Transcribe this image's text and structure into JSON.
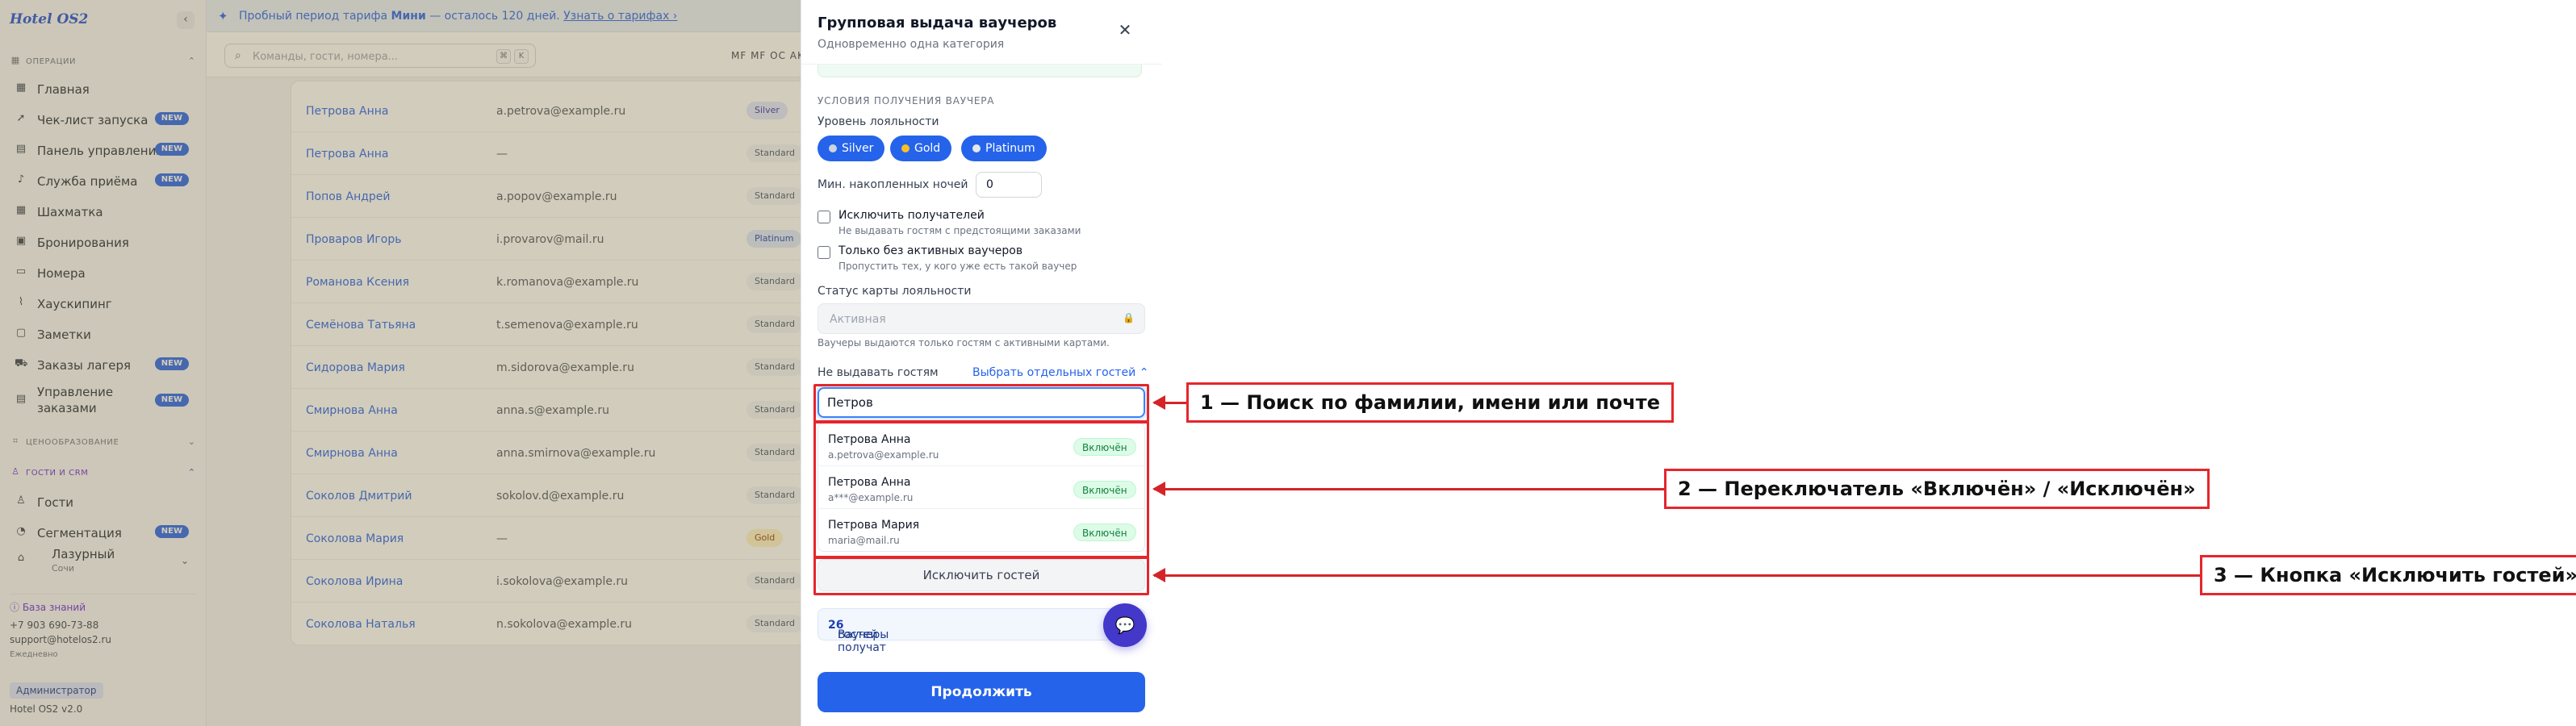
{
  "sidebar": {
    "logo": "Hotel OS2",
    "collapse_icon": "chevron-left-icon",
    "sections": {
      "operations": "ОПЕРАЦИИ",
      "pricing": "ЦЕНООБРАЗОВАНИЕ",
      "guests": "ГОСТИ И CRM"
    },
    "items": [
      {
        "label": "Главная",
        "icon": "grid-icon"
      },
      {
        "label": "Чек-лист запуска",
        "icon": "rocket-icon",
        "badge": "NEW"
      },
      {
        "label": "Панель управления",
        "icon": "dashboard-icon",
        "badge": "NEW"
      },
      {
        "label": "Служба приёма",
        "icon": "bell-icon",
        "badge": "NEW"
      },
      {
        "label": "Шахматка",
        "icon": "table-icon"
      },
      {
        "label": "Бронирования",
        "icon": "calendar-icon"
      },
      {
        "label": "Номера",
        "icon": "bed-icon"
      },
      {
        "label": "Хаускипинг",
        "icon": "broom-icon"
      },
      {
        "label": "Заметки",
        "icon": "note-icon"
      },
      {
        "label": "Заказы лагеря",
        "icon": "cart-icon",
        "badge": "NEW"
      },
      {
        "label": "Управление заказами",
        "icon": "clipboard-icon",
        "badge": "NEW"
      },
      {
        "label": "Гости",
        "icon": "users-icon"
      },
      {
        "label": "Сегментация",
        "icon": "segment-icon",
        "badge": "NEW"
      }
    ],
    "org": {
      "name": "Лазурный",
      "city": "Сочи"
    },
    "knowledge_base": "База знаний",
    "phone": "+7 903 690-73-88",
    "email": "support@hotelos2.ru",
    "schedule": "Ежедневно",
    "role": "Администратор",
    "version": "Hotel OS2 v2.0"
  },
  "banner": {
    "text": "Пробный период тарифа",
    "plan": "Мини",
    "rest": " — осталось 120 дней.",
    "link": "Узнать о тарифах ›"
  },
  "topbar": {
    "search_placeholder": "Команды, гости, номера...",
    "kbd1": "⌘",
    "kbd2": "K",
    "codes": "MF MF OC AK"
  },
  "guests_table": [
    {
      "name": "Петрова Анна",
      "email": "a.petrova@example.ru",
      "tier": "Silver",
      "cls": "silver"
    },
    {
      "name": "Петрова Анна",
      "email": "—",
      "tier": "Standard",
      "cls": "std"
    },
    {
      "name": "Попов Андрей",
      "email": "a.popov@example.ru",
      "tier": "Standard",
      "cls": "std"
    },
    {
      "name": "Проваров Игорь",
      "email": "i.provarov@mail.ru",
      "tier": "Platinum",
      "cls": "plat"
    },
    {
      "name": "Романова Ксения",
      "email": "k.romanova@example.ru",
      "tier": "Standard",
      "cls": "std"
    },
    {
      "name": "Семёнова Татьяна",
      "email": "t.semenova@example.ru",
      "tier": "Standard",
      "cls": "std"
    },
    {
      "name": "Сидорова Мария",
      "email": "m.sidorova@example.ru",
      "tier": "Standard",
      "cls": "std"
    },
    {
      "name": "Смирнова Анна",
      "email": "anna.s@example.ru",
      "tier": "Standard",
      "cls": "std"
    },
    {
      "name": "Смирнова Анна",
      "email": "anna.smirnova@example.ru",
      "tier": "Standard",
      "cls": "std"
    },
    {
      "name": "Соколов Дмитрий",
      "email": "sokolov.d@example.ru",
      "tier": "Standard",
      "cls": "std"
    },
    {
      "name": "Соколова Мария",
      "email": "—",
      "tier": "Gold",
      "cls": "gold"
    },
    {
      "name": "Соколова Ирина",
      "email": "i.sokolova@example.ru",
      "tier": "Standard",
      "cls": "std"
    },
    {
      "name": "Соколова Наталья",
      "email": "n.sokolova@example.ru",
      "tier": "Standard",
      "cls": "std"
    }
  ],
  "drawer": {
    "title": "Групповая выдача ваучеров",
    "subtitle": "Одновременно одна категория",
    "close_icon": "close-icon",
    "conditions_heading": "УСЛОВИЯ ПОЛУЧЕНИЯ ВАУЧЕРА",
    "loyalty_label": "Уровень лояльности",
    "levels": [
      {
        "label": "Silver",
        "medal": "#cbd5e1"
      },
      {
        "label": "Gold",
        "medal": "#fbbf24"
      },
      {
        "label": "Platinum",
        "medal": "#e5e7eb"
      }
    ],
    "min_nights_label": "Мин. накопленных ночей",
    "min_nights_value": "0",
    "exclude_recipients": {
      "label": "Исключить получателей",
      "hint": "Не выдавать гостям с предстоящими заказами"
    },
    "no_active": {
      "label": "Только без активных ваучеров",
      "hint": "Пропустить тех, у кого уже есть такой ваучер"
    },
    "card_status_label": "Статус карты лояльности",
    "card_status_value": "Активная",
    "card_note": "Ваучеры выдаются только гостям с активными картами.",
    "exclude_label": "Не выдавать гостям",
    "pick_link": "Выбрать отдельных гостей ⌃",
    "search_value": "Петров",
    "results": [
      {
        "name": "Петрова Анна",
        "email": "a.petrova@example.ru",
        "status": "Включён"
      },
      {
        "name": "Петрова Анна",
        "email": "a***@example.ru",
        "status": "Включён"
      },
      {
        "name": "Петрова Мария",
        "email": "maria@mail.ru",
        "status": "Включён"
      }
    ],
    "exclude_button": "Исключить гостей",
    "summary_pre": "Ваучеры получат ",
    "summary_count": "26",
    "summary_post": " гостей",
    "continue": "Продолжить"
  },
  "annotations": [
    "1 — Поиск по фамилии, имени или почте",
    "2 — Переключатель «Включён» / «Исключён»",
    "3 — Кнопка «Исключить гостей»"
  ],
  "colors": {
    "accent": "#2563eb",
    "annotation": "#e5262b",
    "included": "#15803d"
  }
}
